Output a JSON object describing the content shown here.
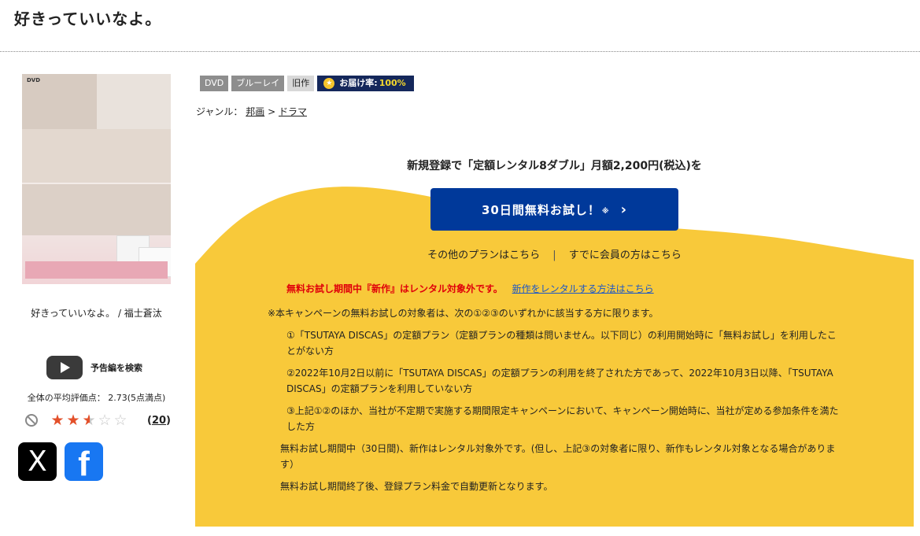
{
  "page": {
    "title": "好きっていいなよ。"
  },
  "jacket": {
    "format_mark": "DVD",
    "caption": "好きっていいなよ。 / 福士蒼汰"
  },
  "trailer": {
    "label": "予告編を検索"
  },
  "rating": {
    "average_text": "全体の平均評価点： 2.73(5点満点)",
    "average": 2.73,
    "max": 5,
    "review_count": "20",
    "open_paren": "(",
    "close_paren": ")"
  },
  "social": {
    "x_glyph": "X",
    "fb_glyph": "f"
  },
  "badges": {
    "dvd": "DVD",
    "bluray": "ブルーレイ",
    "old": "旧作",
    "delivery_label": "お届け率:",
    "delivery_rate": "100%"
  },
  "genre": {
    "label": "ジャンル：",
    "parent": "邦画",
    "sep": ">",
    "child": "ドラマ"
  },
  "promo": {
    "headline": "新規登録で「定額レンタル8ダブル」月額2,200円(税込)を",
    "cta_label": "30日間無料お試し！",
    "cta_note": "※",
    "cta_chevron": "›",
    "other_plans": "その他のプランはこちら",
    "divider": "|",
    "member_link": "すでに会員の方はこちら",
    "warning_red": "無料お試し期間中『新作』はレンタル対象外です。",
    "warning_link": "新作をレンタルする方法はこちら"
  },
  "terms": {
    "intro": "※本キャンペーンの無料お試しの対象者は、次の①②③のいずれかに該当する方に限ります。",
    "item1": "①「TSUTAYA DISCAS」の定額プラン（定額プランの種類は問いません。以下同じ）の利用開始時に「無料お試し」を利用したことがない方",
    "item2": "②2022年10月2日以前に「TSUTAYA DISCAS」の定額プランの利用を終了された方であって、2022年10月3日以降、「TSUTAYA DISCAS」の定額プランを利用していない方",
    "item3": "③上記①②のほか、当社が不定期で実施する期間限定キャンペーンにおいて、キャンペーン開始時に、当社が定める参加条件を満たした方",
    "note1": "無料お試し期間中（30日間)、新作はレンタル対象外です。(但し、上記③の対象者に限り、新作もレンタル対象となる場合があります）",
    "note2": "無料お試し期間終了後、登録プラン料金で自動更新となります。"
  },
  "colors": {
    "promo_yellow": "#f8c93a",
    "cta_blue": "#00399a",
    "warning_red": "#e0000a",
    "link_blue": "#1a56c8",
    "star": "#e3502a"
  }
}
